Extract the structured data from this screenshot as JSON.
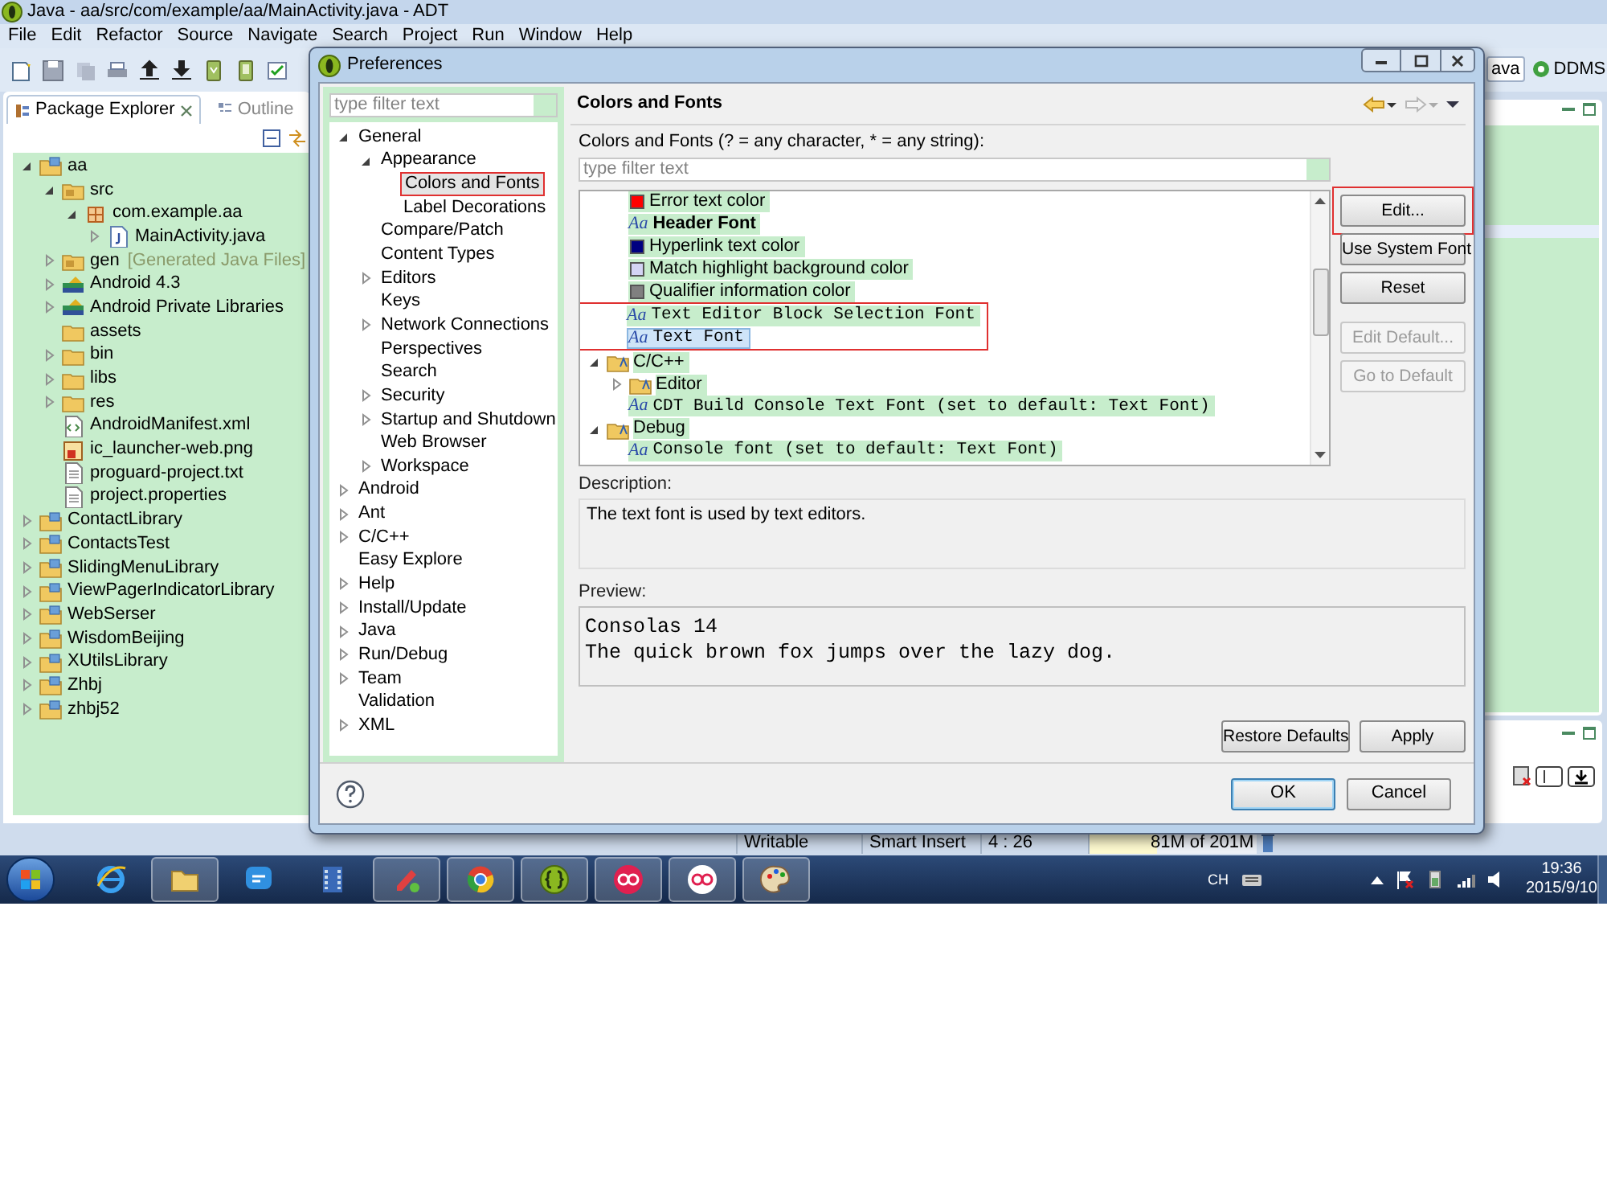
{
  "window": {
    "title": "Java - aa/src/com/example/aa/MainActivity.java - ADT"
  },
  "menu": [
    "File",
    "Edit",
    "Refactor",
    "Source",
    "Navigate",
    "Search",
    "Project",
    "Run",
    "Window",
    "Help"
  ],
  "perspectives": [
    {
      "label": "ava",
      "selected": true
    },
    {
      "label": "DDMS",
      "selected": false
    }
  ],
  "view_tabs": [
    {
      "label": "Package Explorer",
      "selected": true
    },
    {
      "label": "Outline",
      "selected": false
    }
  ],
  "package_tree": [
    {
      "label": "aa",
      "kind": "project",
      "expanded": true,
      "children": [
        {
          "label": "src",
          "kind": "source-folder",
          "expanded": true,
          "children": [
            {
              "label": "com.example.aa",
              "kind": "package",
              "expanded": true,
              "children": [
                {
                  "label": "MainActivity.java",
                  "kind": "java",
                  "expanded": false
                }
              ]
            }
          ]
        },
        {
          "label": "gen",
          "note": "[Generated Java Files]",
          "kind": "source-folder",
          "expanded": false
        },
        {
          "label": "Android 4.3",
          "kind": "library",
          "expanded": false
        },
        {
          "label": "Android Private Libraries",
          "kind": "library",
          "expanded": false
        },
        {
          "label": "assets",
          "kind": "folder"
        },
        {
          "label": "bin",
          "kind": "folder",
          "expanded": false
        },
        {
          "label": "libs",
          "kind": "folder",
          "expanded": false
        },
        {
          "label": "res",
          "kind": "folder",
          "expanded": false
        },
        {
          "label": "AndroidManifest.xml",
          "kind": "xml"
        },
        {
          "label": "ic_launcher-web.png",
          "kind": "image"
        },
        {
          "label": "proguard-project.txt",
          "kind": "text"
        },
        {
          "label": "project.properties",
          "kind": "text"
        }
      ]
    },
    {
      "label": "ContactLibrary",
      "kind": "project",
      "expanded": false
    },
    {
      "label": "ContactsTest",
      "kind": "project",
      "expanded": false
    },
    {
      "label": "SlidingMenuLibrary",
      "kind": "project",
      "expanded": false
    },
    {
      "label": "ViewPagerIndicatorLibrary",
      "kind": "project",
      "expanded": false
    },
    {
      "label": "WebSerser",
      "kind": "project",
      "expanded": false
    },
    {
      "label": "WisdomBeijing",
      "kind": "project",
      "expanded": false
    },
    {
      "label": "XUtilsLibrary",
      "kind": "project",
      "expanded": false
    },
    {
      "label": "Zhbj",
      "kind": "project",
      "expanded": false
    },
    {
      "label": "zhbj52",
      "kind": "project",
      "expanded": false
    }
  ],
  "status_bar": [
    "Writable",
    "Smart Insert",
    "4 : 26"
  ],
  "heap": {
    "used": "81M",
    "total": "of 201M",
    "level": 0.4
  },
  "dialog": {
    "title": "Preferences",
    "filter": {
      "placeholder": "type filter text"
    },
    "tree": [
      {
        "label": "General",
        "expanded": true,
        "selected": false,
        "children": [
          {
            "label": "Appearance",
            "expanded": true,
            "selected": false,
            "children": [
              {
                "label": "Colors and Fonts",
                "selected": true,
                "marked": true
              },
              {
                "label": "Label Decorations",
                "selected": false
              }
            ]
          },
          {
            "label": "Compare/Patch",
            "selected": false
          },
          {
            "label": "Content Types",
            "selected": false
          },
          {
            "label": "Editors",
            "expanded": false,
            "selected": false
          },
          {
            "label": "Keys",
            "selected": false
          },
          {
            "label": "Network Connections",
            "expanded": false,
            "selected": false
          },
          {
            "label": "Perspectives",
            "selected": false
          },
          {
            "label": "Search",
            "selected": false
          },
          {
            "label": "Security",
            "expanded": false,
            "selected": false
          },
          {
            "label": "Startup and Shutdown",
            "expanded": false,
            "selected": false
          },
          {
            "label": "Web Browser",
            "selected": false
          },
          {
            "label": "Workspace",
            "expanded": false,
            "selected": false
          }
        ]
      },
      {
        "label": "Android",
        "expanded": false,
        "selected": false
      },
      {
        "label": "Ant",
        "expanded": false,
        "selected": false
      },
      {
        "label": "C/C++",
        "expanded": false,
        "selected": false
      },
      {
        "label": "Easy Explore",
        "selected": false
      },
      {
        "label": "Help",
        "expanded": false,
        "selected": false
      },
      {
        "label": "Install/Update",
        "expanded": false,
        "selected": false
      },
      {
        "label": "Java",
        "expanded": false,
        "selected": false
      },
      {
        "label": "Run/Debug",
        "expanded": false,
        "selected": false
      },
      {
        "label": "Team",
        "expanded": false,
        "selected": false
      },
      {
        "label": "Validation",
        "selected": false
      },
      {
        "label": "XML",
        "expanded": false,
        "selected": false
      }
    ],
    "page_title": "Colors and Fonts",
    "page_hint": "Colors and Fonts (? = any character, * = any string):",
    "items_filter": {
      "placeholder": "type filter text"
    },
    "items": [
      {
        "kind": "group",
        "children": [
          {
            "kind": "color",
            "label": "Error text color",
            "color": "#ff0000",
            "selected": false
          },
          {
            "kind": "header-font",
            "glyph": "Aa",
            "label": "Header Font",
            "selected": false
          },
          {
            "kind": "color",
            "label": "Hyperlink text color",
            "color": "#000080",
            "selected": false
          },
          {
            "kind": "color",
            "label": "Match highlight background color",
            "color": "#d4d4f4",
            "selected": false
          },
          {
            "kind": "color",
            "label": "Qualifier information color",
            "color": "#808080",
            "selected": false
          },
          {
            "kind": "editor-font",
            "glyph": "Aa",
            "label": "Text Editor Block Selection Font",
            "selected": false,
            "marked": true
          },
          {
            "kind": "editor-font",
            "glyph": "Aa",
            "label": "Text Font",
            "selected": true,
            "marked": true
          }
        ]
      },
      {
        "kind": "category",
        "label": "C/C++",
        "expanded": true,
        "children": [
          {
            "kind": "category",
            "label": "Editor",
            "expanded": false
          },
          {
            "kind": "editor-font",
            "glyph": "Aa",
            "label": "CDT Build Console Text Font (set to default: Text Font)",
            "selected": false
          }
        ]
      },
      {
        "kind": "category",
        "label": "Debug",
        "expanded": true,
        "children": [
          {
            "kind": "editor-font",
            "glyph": "Aa",
            "label": "Console font (set to default: Text Font)",
            "selected": false
          }
        ]
      }
    ],
    "side_buttons": [
      {
        "label": "Edit...",
        "disabled": false,
        "marked": true
      },
      {
        "label": "Use System Font",
        "disabled": false
      },
      {
        "label": "Reset",
        "disabled": false
      },
      {
        "label": "Edit Default...",
        "disabled": true
      },
      {
        "label": "Go to Default",
        "disabled": true
      }
    ],
    "description_label": "Description:",
    "description": "The text font is used by text editors.",
    "preview_label": "Preview:",
    "preview_lines": [
      "Consolas 14",
      "The quick brown fox jumps over the lazy dog."
    ],
    "page_buttons": [
      "Restore Defaults",
      "Apply"
    ],
    "dialog_buttons": [
      {
        "label": "OK",
        "default": true
      },
      {
        "label": "Cancel",
        "default": false
      }
    ]
  },
  "taskbar": {
    "apps": [
      {
        "kind": "browser",
        "running": false
      },
      {
        "kind": "folder",
        "running": true
      },
      {
        "kind": "chat",
        "running": false
      },
      {
        "kind": "film",
        "running": false
      },
      {
        "kind": "pencil",
        "running": true
      },
      {
        "kind": "globe",
        "running": true
      },
      {
        "kind": "braces",
        "running": true
      },
      {
        "kind": "rings",
        "running": true
      },
      {
        "kind": "rings-light",
        "running": true
      },
      {
        "kind": "palette",
        "running": true
      }
    ],
    "ime": "CH",
    "time": "19:36",
    "date": "2015/9/10"
  }
}
